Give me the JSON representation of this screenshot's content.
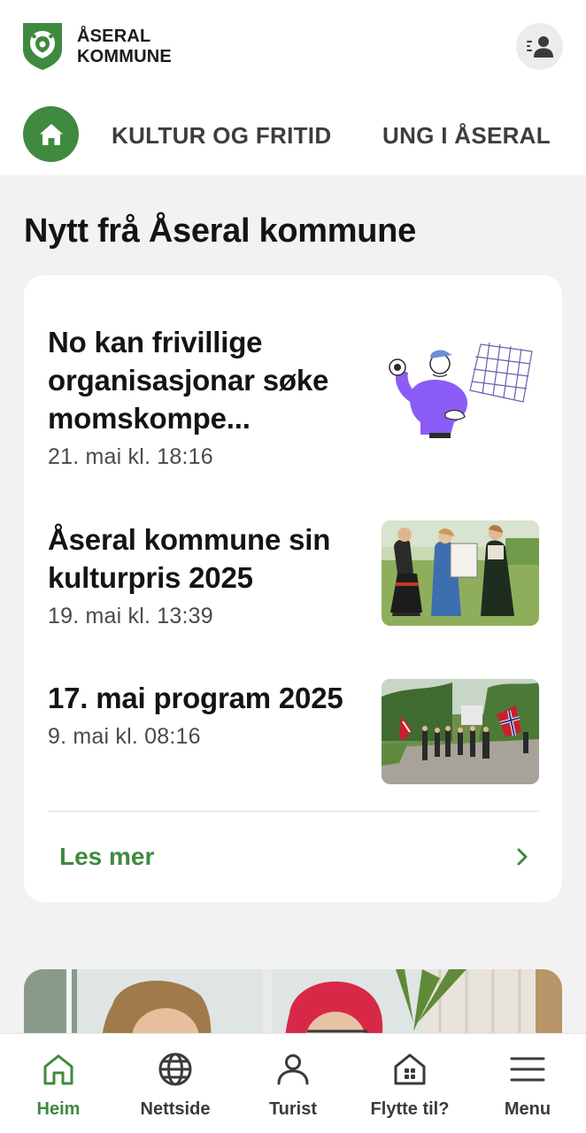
{
  "header": {
    "logo_line1": "ÅSERAL",
    "logo_line2": "KOMMUNE",
    "profile_icon": "profile-list-icon"
  },
  "top_nav": {
    "home_icon": "home-icon",
    "links": [
      {
        "label": "KULTUR OG FRITID"
      },
      {
        "label": "UNG I ÅSERAL"
      }
    ]
  },
  "news": {
    "section_title": "Nytt frå Åseral kommune",
    "items": [
      {
        "title": "No kan frivillige organisasjonar søke momskompe...",
        "date": "21. mai kl. 18:16"
      },
      {
        "title": "Åseral kommune sin kulturpris 2025",
        "date": "19. mai kl. 13:39"
      },
      {
        "title": "17. mai program 2025",
        "date": "9. mai kl. 08:16"
      }
    ],
    "read_more": "Les mer"
  },
  "bottom_nav": {
    "tabs": [
      {
        "label": "Heim",
        "icon": "home-outline-icon",
        "active": true
      },
      {
        "label": "Nettside",
        "icon": "globe-icon",
        "active": false
      },
      {
        "label": "Turist",
        "icon": "person-icon",
        "active": false
      },
      {
        "label": "Flytte til?",
        "icon": "house-grid-icon",
        "active": false
      },
      {
        "label": "Menu",
        "icon": "hamburger-icon",
        "active": false
      }
    ]
  },
  "colors": {
    "accent": "#3f8a3f",
    "background": "#f2f2f3",
    "card": "#ffffff",
    "text": "#141414",
    "muted": "#4a4a4a"
  }
}
